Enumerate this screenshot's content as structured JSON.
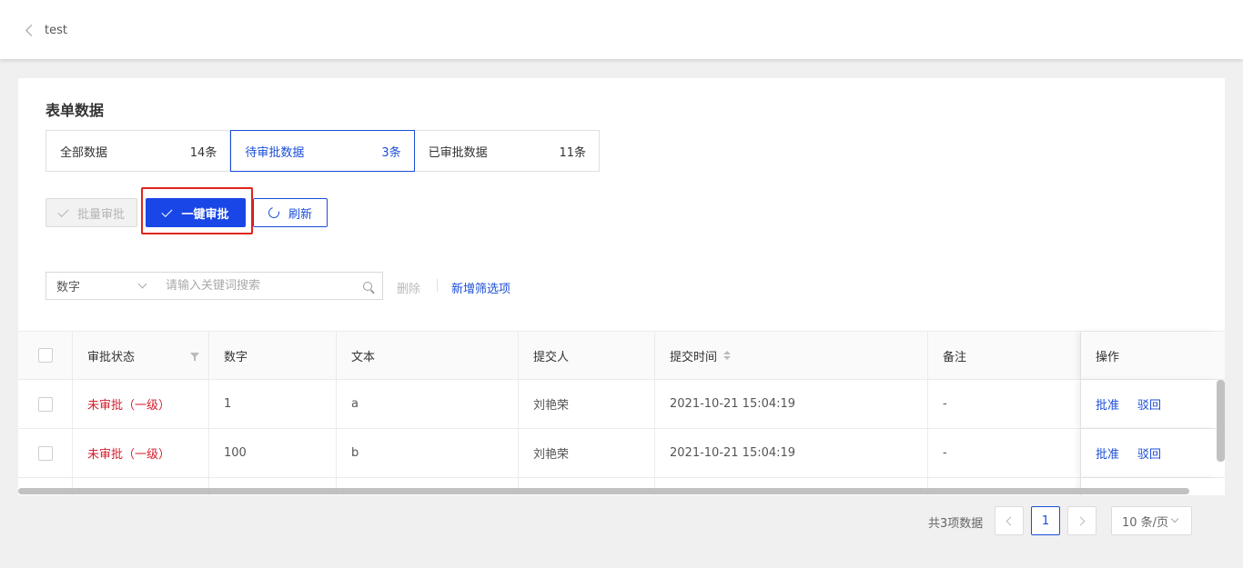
{
  "header": {
    "back_label": "test"
  },
  "section": {
    "title": "表单数据"
  },
  "tabs": [
    {
      "label": "全部数据",
      "count": "14条"
    },
    {
      "label": "待审批数据",
      "count": "3条"
    },
    {
      "label": "已审批数据",
      "count": "11条"
    }
  ],
  "actions": {
    "batch_approve": "批量审批",
    "one_click_approve": "一键审批",
    "refresh": "刷新"
  },
  "filter": {
    "field": "数字",
    "search_placeholder": "请输入关键词搜索",
    "delete": "删除",
    "add_filter": "新增筛选项"
  },
  "table": {
    "columns": [
      "审批状态",
      "数字",
      "文本",
      "提交人",
      "提交时间",
      "备注",
      "操作"
    ],
    "rows": [
      {
        "status": "未审批（一级）",
        "number": "1",
        "text": "a",
        "submitter": "刘艳荣",
        "time": "2021-10-21 15:04:19",
        "note": "-"
      },
      {
        "status": "未审批（一级）",
        "number": "100",
        "text": "b",
        "submitter": "刘艳荣",
        "time": "2021-10-21 15:04:19",
        "note": "-"
      }
    ],
    "row_actions": {
      "approve": "批准",
      "reject": "驳回"
    }
  },
  "pagination": {
    "total": "共3项数据",
    "current": "1",
    "page_size": "10 条/页"
  },
  "colors": {
    "primary": "#1946e6",
    "danger": "#d4202f",
    "highlight": "#e0241a"
  }
}
